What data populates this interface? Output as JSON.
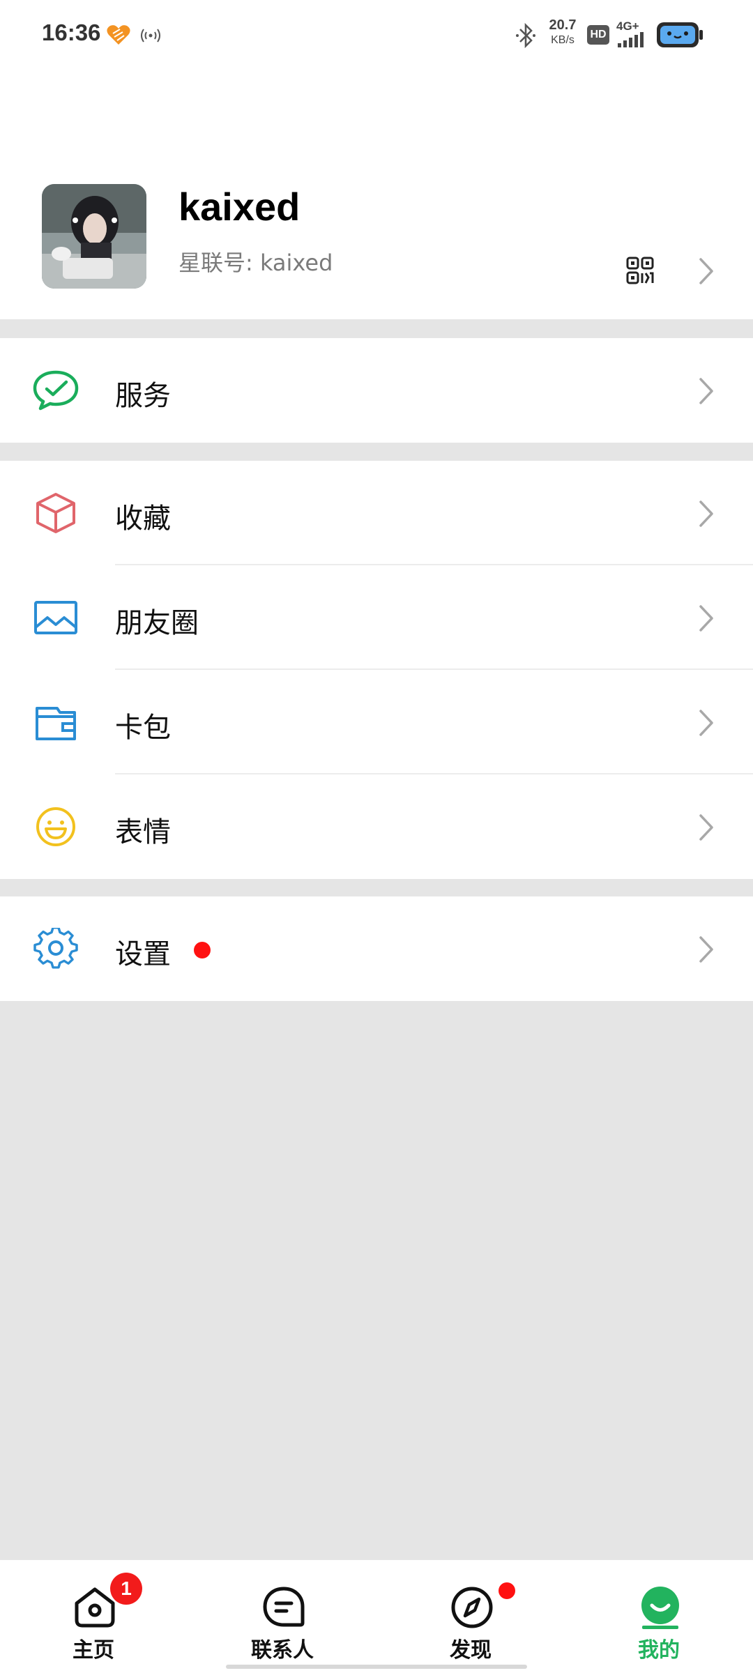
{
  "status_bar": {
    "time": "16:36",
    "net_speed_value": "20.7",
    "net_speed_unit": "KB/s",
    "hd_label": "HD",
    "network_label": "4G+"
  },
  "profile": {
    "name": "kaixed",
    "account_id": "星联号: kaixed"
  },
  "menu": {
    "service": {
      "label": "服务",
      "icon": "chat-check-icon",
      "color": "#1aad5b"
    },
    "favorites": {
      "label": "收藏",
      "icon": "cube-icon",
      "color": "#e0656b"
    },
    "moments": {
      "label": "朋友圈",
      "icon": "image-icon",
      "color": "#2a8dd4"
    },
    "wallet": {
      "label": "卡包",
      "icon": "wallet-icon",
      "color": "#2a8dd4"
    },
    "stickers": {
      "label": "表情",
      "icon": "smile-icon",
      "color": "#f2c11e"
    },
    "settings": {
      "label": "设置",
      "icon": "gear-icon",
      "color": "#2a8dd4"
    }
  },
  "tabbar": {
    "home": {
      "label": "主页",
      "badge": "1"
    },
    "contacts": {
      "label": "联系人"
    },
    "discover": {
      "label": "发现"
    },
    "me": {
      "label": "我的",
      "active": true
    }
  },
  "colors": {
    "accent": "#22b35e",
    "badge": "#f21b1b",
    "background": "#e5e5e5"
  }
}
